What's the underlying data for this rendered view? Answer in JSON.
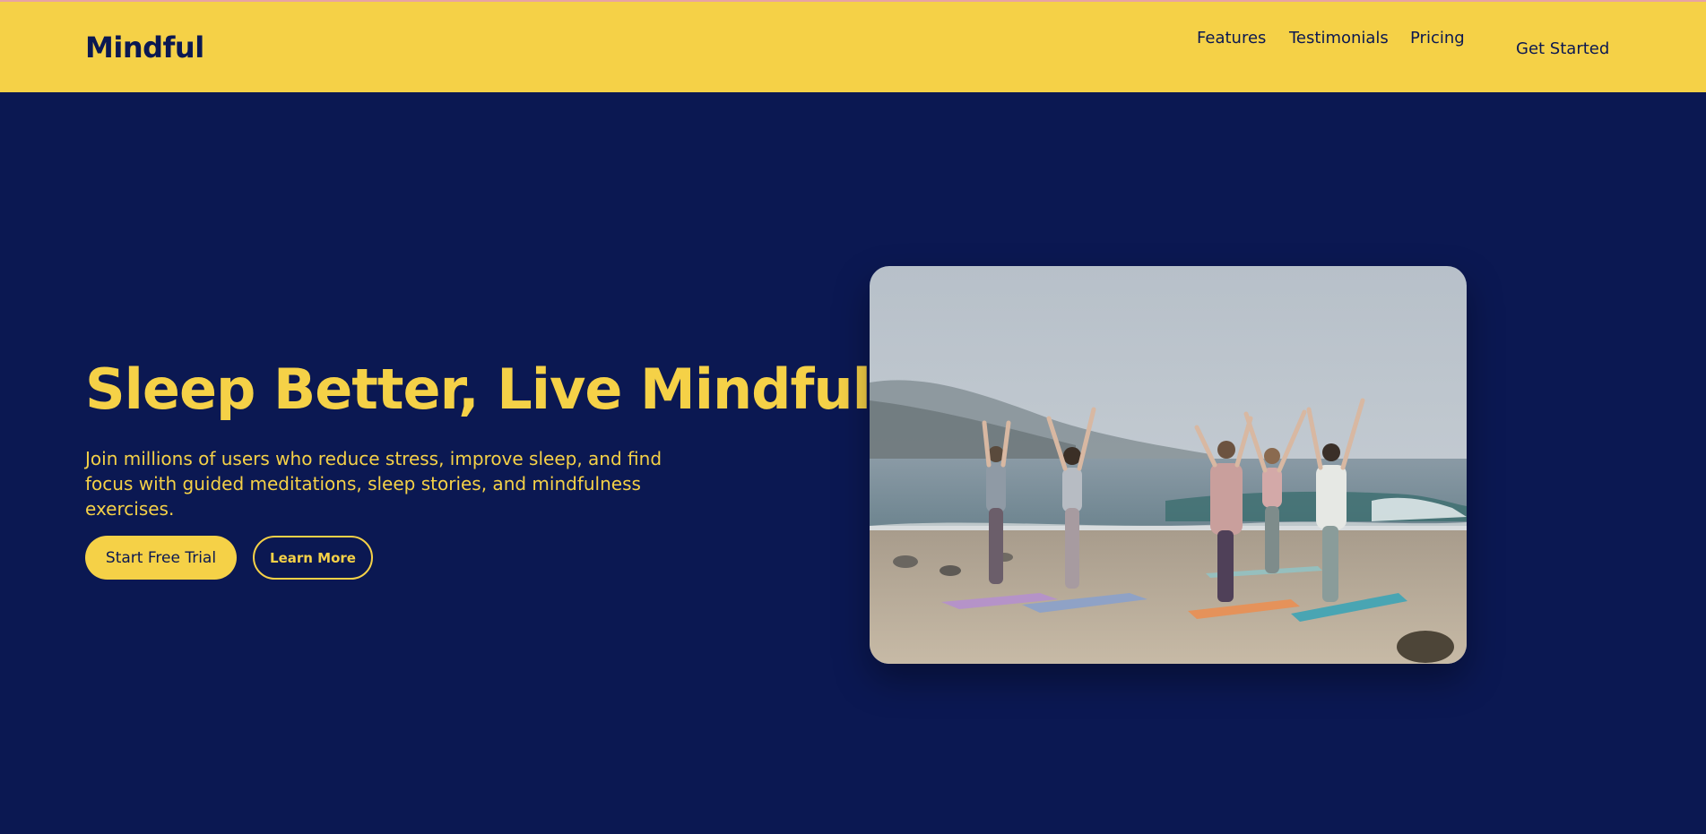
{
  "app": {
    "brand": "Mindful"
  },
  "nav": {
    "items": [
      {
        "label": "Features"
      },
      {
        "label": "Testimonials"
      },
      {
        "label": "Pricing"
      }
    ],
    "cta": "Get Started"
  },
  "hero": {
    "title": "Sleep Better, Live Mindfully",
    "subtitle": "Join millions of users who reduce stress, improve sleep, and find focus with guided meditations, sleep stories, and mindfulness exercises.",
    "primary_button": "Start Free Trial",
    "secondary_button": "Learn More",
    "image_icon": "yoga-beach-photo"
  },
  "colors": {
    "background": "#0b1852",
    "accent": "#f5d147",
    "text_dark": "#0b1852"
  }
}
